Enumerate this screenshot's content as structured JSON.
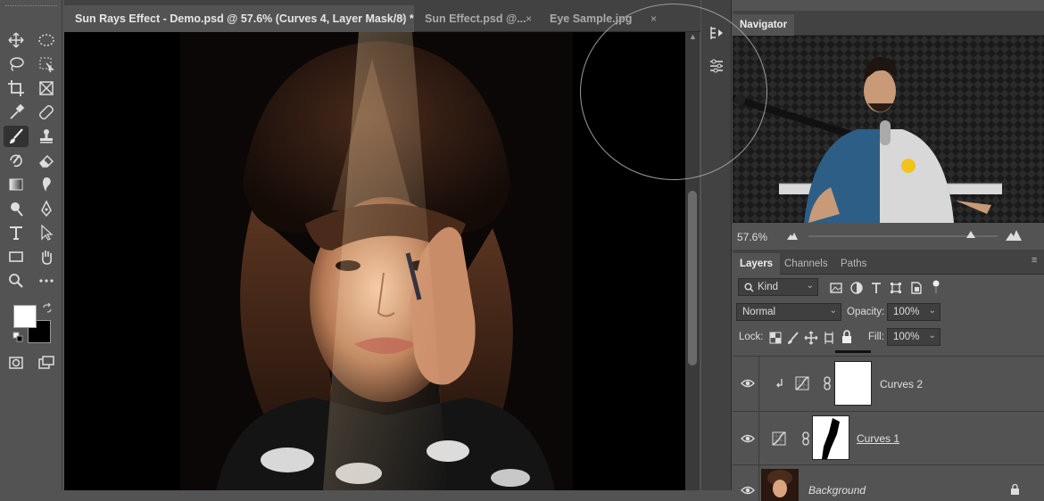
{
  "tabs": [
    {
      "label": "Sun Rays Effect - Demo.psd @ 57.6% (Curves 4, Layer Mask/8) *",
      "active": true
    },
    {
      "label": "Sun Effect.psd @...",
      "active": false
    },
    {
      "label": "Eye Sample.jpg",
      "active": false
    }
  ],
  "tab_close_glyph": "×",
  "toolbar": {
    "tools": [
      "move-icon",
      "marquee-icon",
      "lasso-icon",
      "object-select-icon",
      "crop-icon",
      "frame-icon",
      "eyedropper-icon",
      "healing-icon",
      "brush-icon",
      "stamp-icon",
      "history-brush-icon",
      "eraser-icon",
      "gradient-icon",
      "smudge-icon",
      "dodge-icon",
      "pen-icon",
      "type-icon",
      "path-select-icon",
      "rectangle-icon",
      "hand-icon",
      "zoom-icon",
      "more-icon"
    ],
    "active_tool": "brush-icon",
    "foreground_color": "#ffffff",
    "background_color": "#000000"
  },
  "navigator": {
    "title": "Navigator",
    "zoom": "57.6%"
  },
  "layers_panel": {
    "tabs": [
      "Layers",
      "Channels",
      "Paths"
    ],
    "active_tab": "Layers",
    "filter_label": "Kind",
    "blend_mode": "Normal",
    "opacity_label": "Opacity:",
    "opacity": "100%",
    "lock_label": "Lock:",
    "fill_label": "Fill:",
    "fill": "100%",
    "layers": [
      {
        "name": "Curves 2",
        "visible": true,
        "clipped": true
      },
      {
        "name": "Curves 1",
        "visible": true,
        "clipped": false
      },
      {
        "name": "Background",
        "visible": true,
        "locked": true
      }
    ]
  },
  "colors": {
    "panel_bg": "#535353",
    "header_bg": "#424242",
    "canvas_bg": "#000000"
  }
}
